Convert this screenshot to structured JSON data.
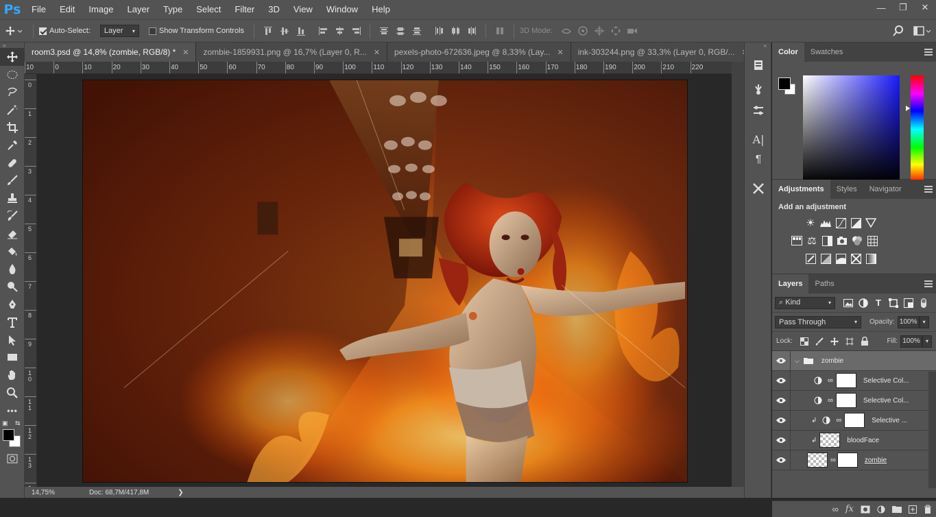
{
  "app": {
    "logo": "Ps",
    "menu": [
      "File",
      "Edit",
      "Image",
      "Layer",
      "Type",
      "Select",
      "Filter",
      "3D",
      "View",
      "Window",
      "Help"
    ]
  },
  "window_controls": [
    "minimize-icon",
    "restore-icon",
    "close-icon"
  ],
  "options_bar": {
    "auto_select_label": "Auto-Select:",
    "auto_select_checked": true,
    "auto_select_target": "Layer",
    "show_transform_label": "Show Transform Controls",
    "show_transform_checked": false,
    "mode_3d_label": "3D Mode:"
  },
  "document_tabs": [
    {
      "label": "room3.psd @ 14,8% (zombie, RGB/8) *",
      "active": true
    },
    {
      "label": "zombie-1859931.png @ 16,7% (Layer 0, R...",
      "active": false
    },
    {
      "label": "pexels-photo-672636.jpeg @ 8,33% (Lay...",
      "active": false
    },
    {
      "label": "ink-303244.png @ 33,3% (Layer 0, RGB/...",
      "active": false
    }
  ],
  "ruler_top": [
    "10",
    "0",
    "10",
    "20",
    "30",
    "40",
    "50",
    "60",
    "70",
    "80",
    "90",
    "100",
    "110",
    "120",
    "130",
    "140",
    "150",
    "160",
    "170",
    "180",
    "190",
    "200",
    "210",
    "220"
  ],
  "ruler_left": [
    "0",
    "1",
    "2",
    "3",
    "4",
    "5",
    "6",
    "7",
    "8",
    "9",
    "1\n0",
    "1\n1",
    "1\n2",
    "1\n3",
    "1\n4"
  ],
  "status": {
    "zoom": "14,75%",
    "doc": "Doc: 68,7M/417,8M"
  },
  "tools": [
    "move-tool-icon",
    "marquee-tool-icon",
    "lasso-tool-icon",
    "magic-wand-tool-icon",
    "crop-tool-icon",
    "eyedropper-tool-icon",
    "healing-brush-tool-icon",
    "brush-tool-icon",
    "clone-stamp-tool-icon",
    "history-brush-tool-icon",
    "eraser-tool-icon",
    "paint-bucket-tool-icon",
    "blur-tool-icon",
    "dodge-tool-icon",
    "pen-tool-icon",
    "type-tool-icon",
    "path-selection-tool-icon",
    "rectangle-tool-icon",
    "hand-tool-icon",
    "zoom-tool-icon",
    "more-tools-icon"
  ],
  "panels": {
    "color_tabs": [
      "Color",
      "Swatches"
    ],
    "adjustments_tabs": [
      "Adjustments",
      "Styles",
      "Navigator"
    ],
    "adjustments_hint": "Add an adjustment",
    "layers_tabs": [
      "Layers",
      "Paths"
    ],
    "filter_kind": "Kind",
    "blend_mode": "Pass Through",
    "opacity_label": "Opacity:",
    "opacity_value": "100%",
    "lock_label": "Lock:",
    "fill_label": "Fill:",
    "fill_value": "100%"
  },
  "layers": [
    {
      "name": "zombie",
      "kind": "group",
      "selected": true
    },
    {
      "name": "Selective Col...",
      "kind": "adjustment"
    },
    {
      "name": "Selective Col...",
      "kind": "adjustment"
    },
    {
      "name": "Selective ...",
      "kind": "adjustment-clipped"
    },
    {
      "name": "bloodFace",
      "kind": "pixel-clipped"
    },
    {
      "name": "zombie",
      "kind": "smart-object"
    }
  ],
  "colors": {
    "foreground": "#000000",
    "background": "#ffffff",
    "picker_hue": "#1a1aff",
    "ps_blue": "#31a8ff"
  }
}
